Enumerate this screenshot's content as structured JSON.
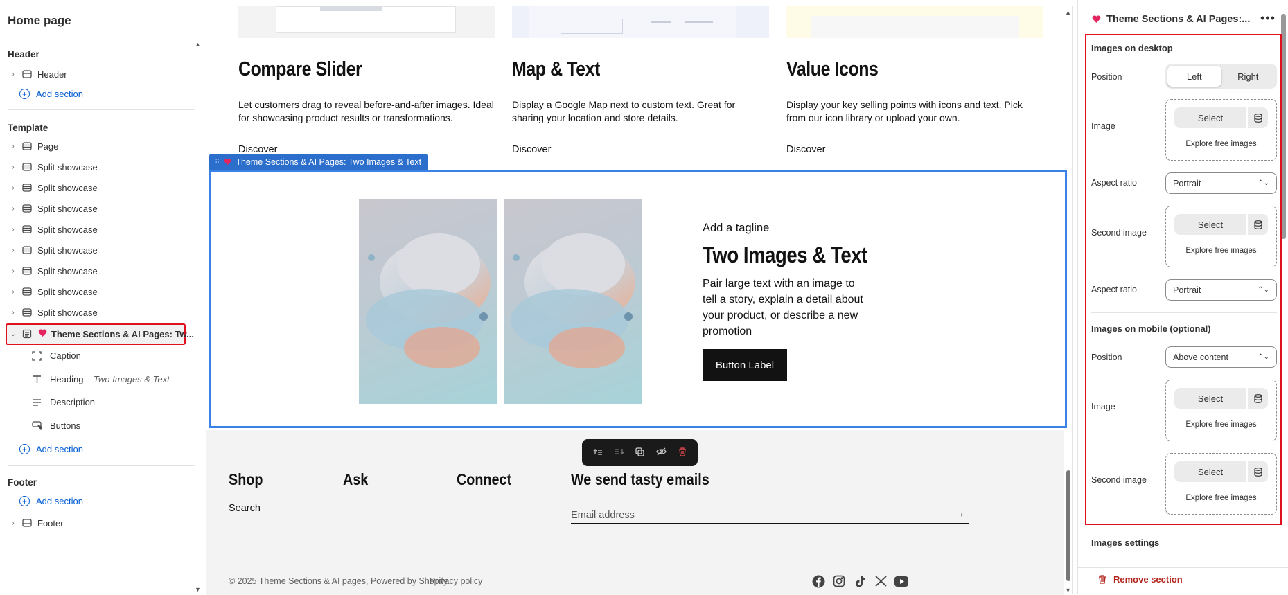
{
  "left_panel": {
    "title": "Home page",
    "header_group": "Header",
    "header_item": "Header",
    "add_section": "Add section",
    "template_group": "Template",
    "template_items": [
      "Page",
      "Split showcase",
      "Split showcase",
      "Split showcase",
      "Split showcase",
      "Split showcase",
      "Split showcase",
      "Split showcase",
      "Split showcase"
    ],
    "selected_item": "Theme Sections & AI Pages: Tw...",
    "blocks": {
      "caption": "Caption",
      "heading": "Heading –",
      "heading_sub": "Two Images & Text",
      "description": "Description",
      "buttons": "Buttons"
    },
    "footer_group": "Footer",
    "footer_item": "Footer"
  },
  "canvas": {
    "cards": [
      {
        "title": "Compare Slider",
        "text": "Let customers drag to reveal before-and-after images. Ideal for showcasing product results or transformations.",
        "link": "Discover"
      },
      {
        "title": "Map & Text",
        "text": "Display a Google Map next to custom text. Great for sharing your location and store details.",
        "link": "Discover"
      },
      {
        "title": "Value Icons",
        "text": "Display your key selling points with icons and text. Pick from our icon library or upload your own.",
        "link": "Discover"
      }
    ],
    "section_label": "Theme Sections & AI Pages: Two Images & Text",
    "tagline": "Add a tagline",
    "heading": "Two Images & Text",
    "description": "Pair large text with an image to tell a story, explain a detail about your product, or describe a new promotion",
    "button": "Button Label",
    "footer": {
      "shop": "Shop",
      "search": "Search",
      "ask": "Ask",
      "connect": "Connect",
      "emails_title": "We send tasty emails",
      "email_placeholder": "Email address",
      "copyright": "© 2025 Theme Sections & AI pages, Powered by Shopify",
      "privacy": "Privacy policy"
    }
  },
  "right_panel": {
    "title": "Theme Sections & AI Pages:...",
    "desktop_title": "Images on desktop",
    "position_label": "Position",
    "pos_left": "Left",
    "pos_right": "Right",
    "image_label": "Image",
    "select": "Select",
    "explore": "Explore free images",
    "aspect_label": "Aspect ratio",
    "aspect_value": "Portrait",
    "second_image_label": "Second image",
    "mobile_title": "Images on mobile (optional)",
    "mobile_position_value": "Above content",
    "images_settings": "Images settings",
    "remove_section": "Remove section"
  },
  "colors": {
    "accent": "#005bd3",
    "highlight_red": "#e0101f",
    "selection_blue": "#3b82e6"
  }
}
